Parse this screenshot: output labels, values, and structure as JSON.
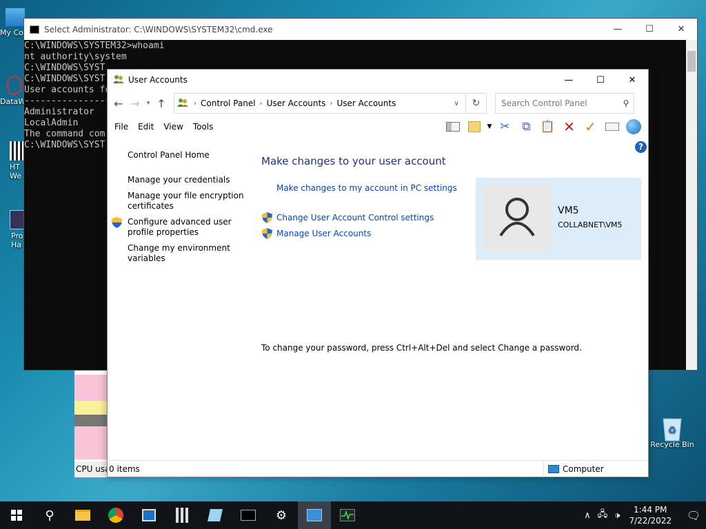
{
  "desktop": {
    "icons": [
      {
        "label": "My Co"
      },
      {
        "label": "DataW"
      },
      {
        "label": "HT We"
      },
      {
        "label": "Pro Ha"
      },
      {
        "label": "Recycle Bin"
      }
    ]
  },
  "cmd": {
    "title": "Select Administrator: C:\\WINDOWS\\SYSTEM32\\cmd.exe",
    "lines": [
      "C:\\WINDOWS\\SYSTEM32>whoami",
      "nt authority\\system",
      "",
      "C:\\WINDOWS\\SYST",
      "",
      "C:\\WINDOWS\\SYST",
      "",
      "User accounts fo",
      "",
      "----------------",
      "Administrator",
      "LocalAdmin",
      "The command com",
      "",
      "C:\\WINDOWS\\SYST"
    ]
  },
  "taskmgr": {
    "label": "CPU usa"
  },
  "ua": {
    "title": "User Accounts",
    "breadcrumb": [
      "Control Panel",
      "User Accounts",
      "User Accounts"
    ],
    "search_placeholder": "Search Control Panel",
    "menu": [
      "File",
      "Edit",
      "View",
      "Tools"
    ],
    "side_links": [
      "Control Panel Home",
      "Manage your credentials",
      "Manage your file encryption certificates",
      "Configure advanced user profile properties",
      "Change my environment variables"
    ],
    "main_title": "Make changes to your user account",
    "links": {
      "pc_settings": "Make changes to my account in PC settings",
      "uac": "Change User Account Control settings",
      "manage": "Manage User Accounts"
    },
    "note": "To change your password, press Ctrl+Alt+Del and select Change a password.",
    "user": {
      "name": "VM5",
      "domain": "COLLABNET\\VM5"
    },
    "status": {
      "items": "0 items",
      "computer": "Computer"
    }
  },
  "taskbar": {
    "time": "1:44 PM",
    "date": "7/22/2022"
  },
  "colors": {
    "link": "#0046be",
    "title": "#1e3287",
    "card": "#ddecf9",
    "taskbar": "#101418"
  }
}
